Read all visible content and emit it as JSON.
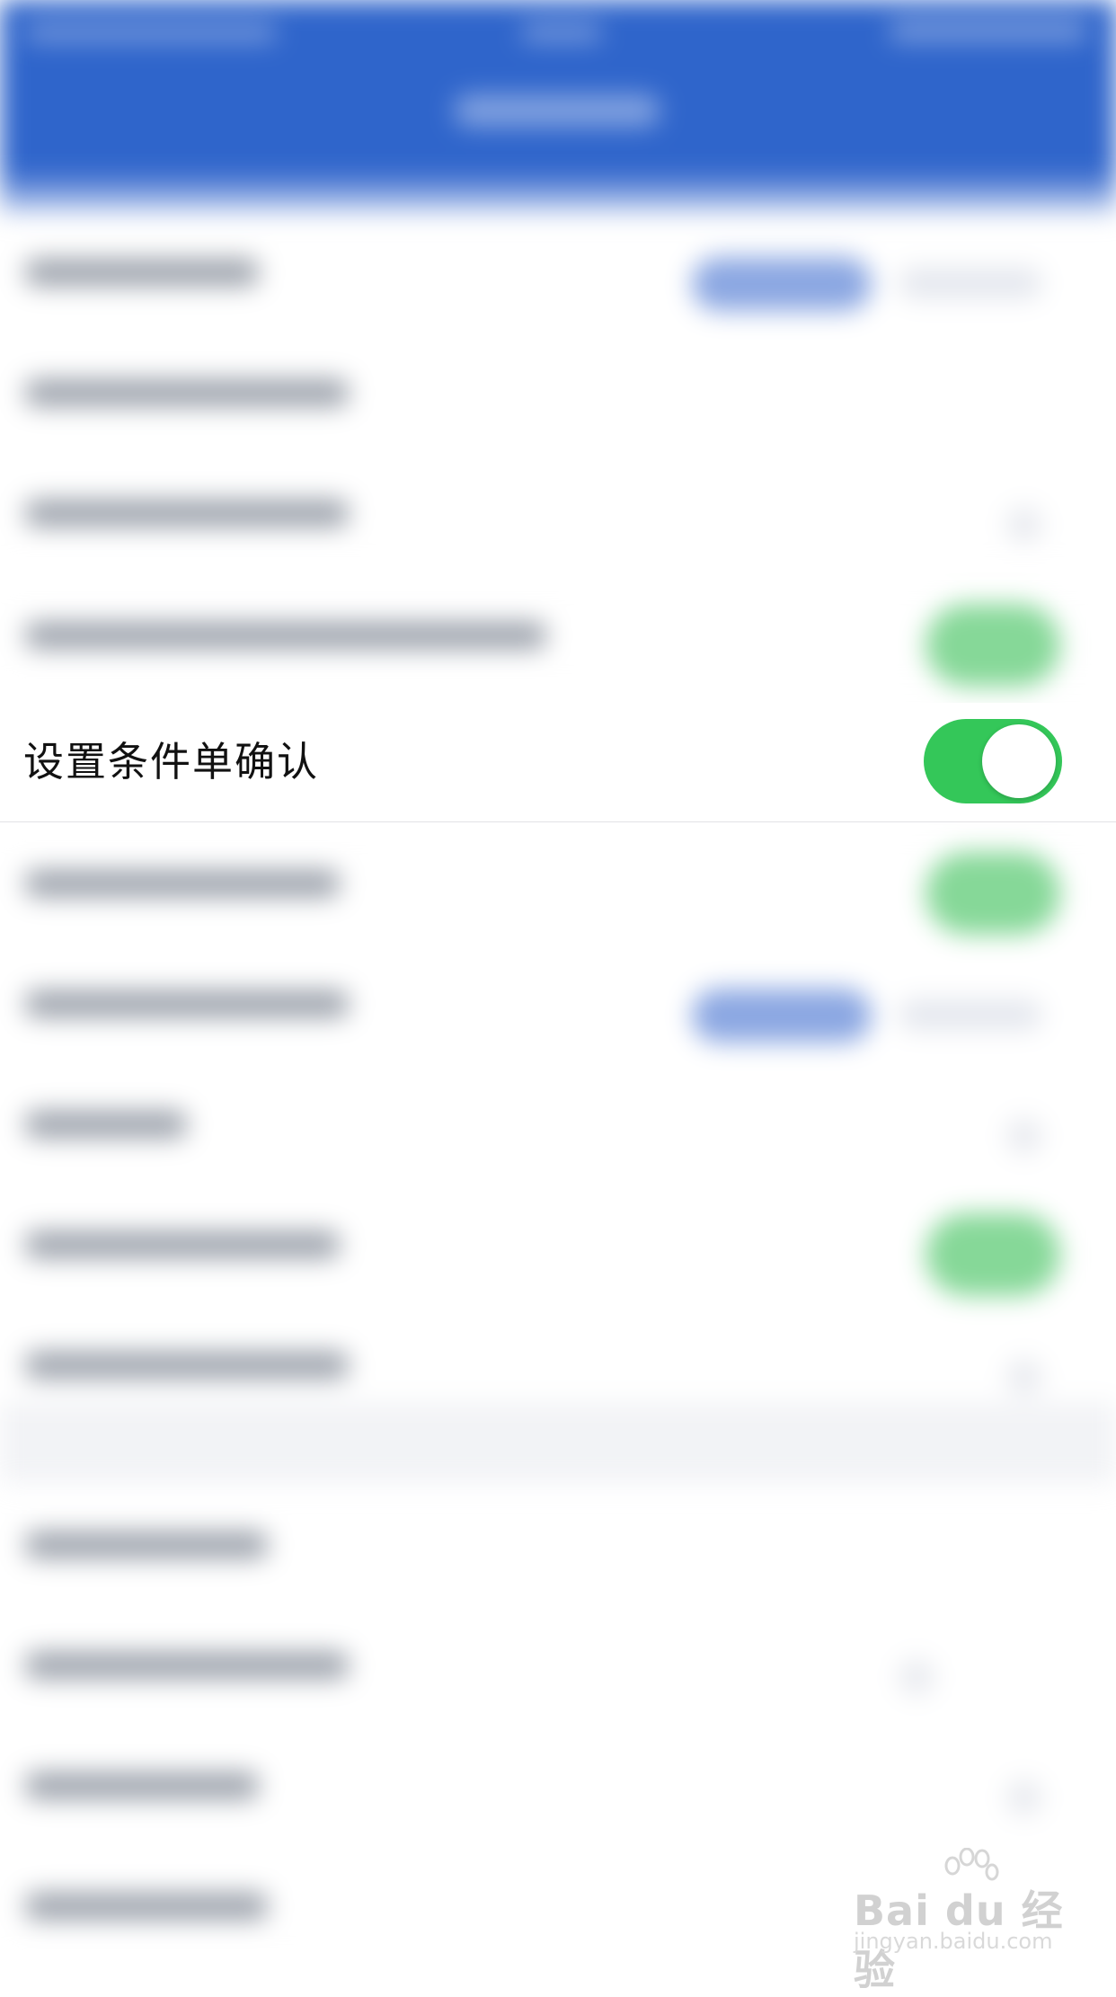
{
  "focused_setting": {
    "label": "设置条件单确认",
    "toggle_on": true,
    "toggle_color": "#34c759"
  },
  "header": {
    "color": "#2f65cb"
  },
  "watermark": {
    "brand": "Bai du 经验",
    "url": "jingyan.baidu.com"
  }
}
